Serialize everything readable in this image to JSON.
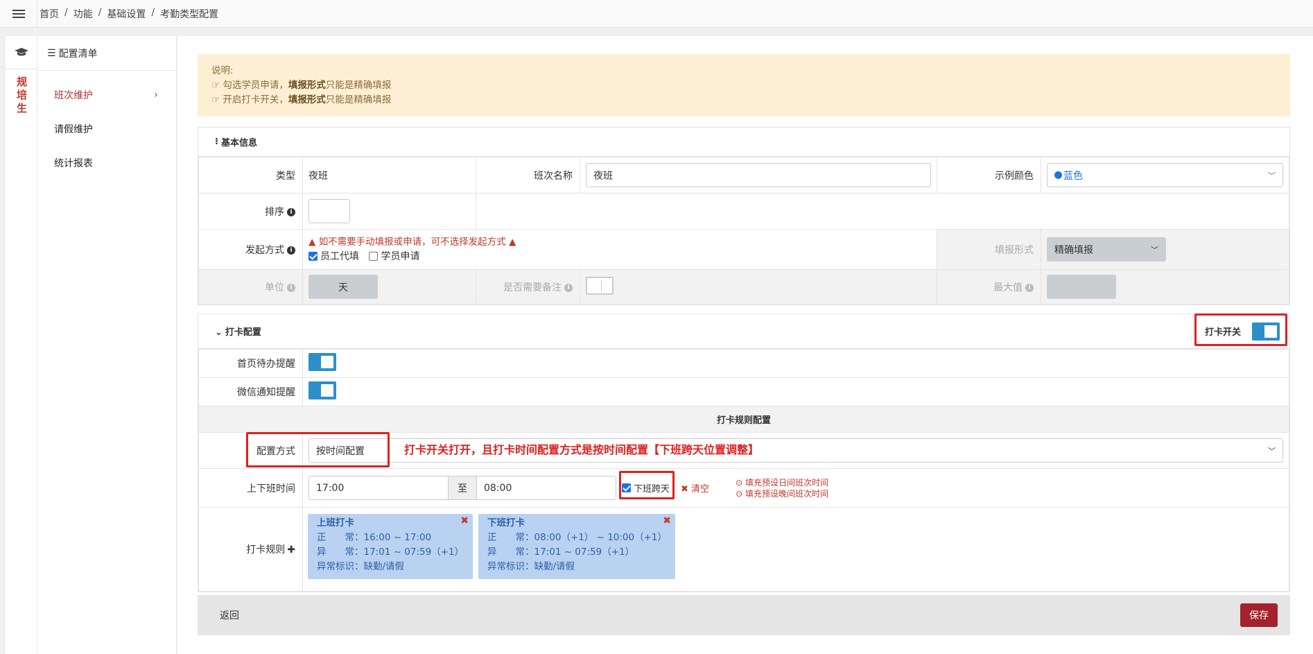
{
  "breadcrumb": [
    "首页",
    "功能",
    "基础设置",
    "考勤类型配置"
  ],
  "sidebar": {
    "vertical_title": "规培生",
    "header": "配置清单",
    "items": [
      {
        "label": "班次维护"
      },
      {
        "label": "请假维护"
      },
      {
        "label": "统计报表"
      }
    ],
    "chevron": "›"
  },
  "notice": {
    "title": "说明:",
    "lines": [
      {
        "pre": "勾选学员申请，",
        "bold": "填报形式",
        "post": "只能是精确填报"
      },
      {
        "pre": "开启打卡开关，",
        "bold": "填报形式",
        "post": "只能是精确填报"
      }
    ]
  },
  "basic": {
    "header": "基本信息",
    "type_label": "类型",
    "type_value": "夜班",
    "name_label": "班次名称",
    "name_value": "夜班",
    "color_label": "示例颜色",
    "color_value": "蓝色",
    "color_hex": "#1a73e8",
    "order_label": "排序",
    "method_label": "发起方式",
    "method_warning": "如不需要手动填报或申请，可不选择发起方式",
    "opt_employee": "员工代填",
    "opt_student": "学员申请",
    "fill_label": "填报形式",
    "fill_value": "精确填报",
    "unit_label": "单位",
    "unit_value": "天",
    "remark_label": "是否需要备注",
    "max_label": "最大值"
  },
  "punch": {
    "header": "打卡配置",
    "switch_label": "打卡开关",
    "home_reminder": "首页待办提醒",
    "wechat_reminder": "微信通知提醒",
    "rules_title": "打卡规则配置",
    "config_label": "配置方式",
    "config_value": "按时间配置",
    "annotation": "打卡开关打开，且打卡时间配置方式是按时间配置【下班跨天位置调整】",
    "time_label": "上下班时间",
    "start": "17:00",
    "to": "至",
    "end": "08:00",
    "cross_day": "下班跨天",
    "clear": "清空",
    "tip1": "填充预设日间班次时间",
    "tip2": "填充预设晚间班次时间",
    "rule_label": "打卡规则",
    "card1": {
      "title": "上班打卡",
      "l1": "正　　常：16:00 ~ 17:00",
      "l2": "异　　常：17:01 ~ 07:59（+1）",
      "l3": "异常标识：缺勤/请假"
    },
    "card2": {
      "title": "下班打卡",
      "l1": "正　　常：08:00（+1） ~ 10:00（+1）",
      "l2": "异　　常：17:01 ~ 07:59（+1）",
      "l3": "异常标识：缺勤/请假"
    }
  },
  "footer": {
    "back": "返回",
    "save": "保存"
  }
}
